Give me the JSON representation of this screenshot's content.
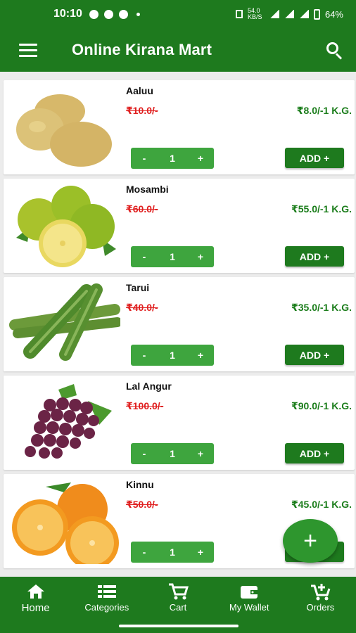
{
  "status_bar": {
    "time": "10:10",
    "network_speed": "54.0\nKB/S",
    "battery": "64%"
  },
  "app_bar": {
    "title": "Online Kirana Mart"
  },
  "products": [
    {
      "name": "Aaluu",
      "mrp": "₹10.0/-",
      "price": "₹8.0/-1 K.G.",
      "qty": "1",
      "minus": "-",
      "plus": "+",
      "add_label": "ADD +"
    },
    {
      "name": "Mosambi",
      "mrp": "₹60.0/-",
      "price": "₹55.0/-1 K.G.",
      "qty": "1",
      "minus": "-",
      "plus": "+",
      "add_label": "ADD +"
    },
    {
      "name": "Tarui",
      "mrp": "₹40.0/-",
      "price": "₹35.0/-1 K.G.",
      "qty": "1",
      "minus": "-",
      "plus": "+",
      "add_label": "ADD +"
    },
    {
      "name": "Lal Angur",
      "mrp": "₹100.0/-",
      "price": "₹90.0/-1 K.G.",
      "qty": "1",
      "minus": "-",
      "plus": "+",
      "add_label": "ADD +"
    },
    {
      "name": "Kinnu",
      "mrp": "₹50.0/-",
      "price": "₹45.0/-1 K.G.",
      "qty": "1",
      "minus": "-",
      "plus": "+",
      "add_label": "ADD +"
    }
  ],
  "fab": {
    "label": "+"
  },
  "bottom_nav": [
    {
      "label": "Home",
      "icon": "home-icon"
    },
    {
      "label": "Categories",
      "icon": "categories-icon"
    },
    {
      "label": "Cart",
      "icon": "cart-icon"
    },
    {
      "label": "My Wallet",
      "icon": "wallet-icon"
    },
    {
      "label": "Orders",
      "icon": "orders-icon"
    }
  ],
  "colors": {
    "primary": "#1e7a1e",
    "button": "#3ea53e",
    "mrp_strike": "#e02020",
    "price": "#1b7d1b"
  }
}
